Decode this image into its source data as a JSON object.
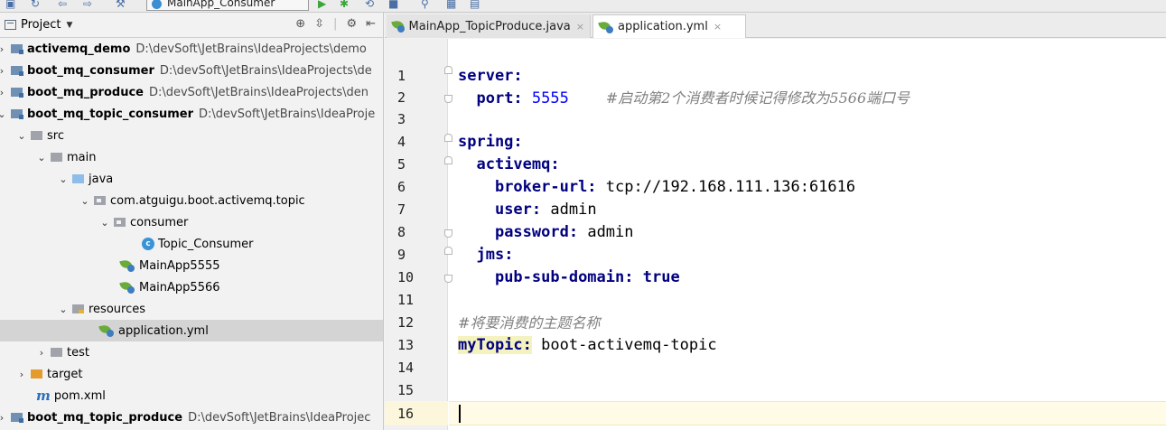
{
  "toolbar": {
    "run_config_label": "MainApp_Consumer"
  },
  "project_panel": {
    "title": "Project",
    "tree": [
      {
        "label": "activemq_demo",
        "path": "D:\\devSoft\\JetBrains\\IdeaProjects\\demo"
      },
      {
        "label": "boot_mq_consumer",
        "path": "D:\\devSoft\\JetBrains\\IdeaProjects\\de"
      },
      {
        "label": "boot_mq_produce",
        "path": "D:\\devSoft\\JetBrains\\IdeaProjects\\den"
      },
      {
        "label": "boot_mq_topic_consumer",
        "path": "D:\\devSoft\\JetBrains\\IdeaProje"
      },
      {
        "label": "src"
      },
      {
        "label": "main"
      },
      {
        "label": "java"
      },
      {
        "label": "com.atguigu.boot.activemq.topic"
      },
      {
        "label": "consumer"
      },
      {
        "label": "Topic_Consumer"
      },
      {
        "label": "MainApp5555"
      },
      {
        "label": "MainApp5566"
      },
      {
        "label": "resources"
      },
      {
        "label": "application.yml"
      },
      {
        "label": "test"
      },
      {
        "label": "target"
      },
      {
        "label": "pom.xml"
      },
      {
        "label": "boot_mq_topic_produce",
        "path": "D:\\devSoft\\JetBrains\\IdeaProjec"
      }
    ]
  },
  "tabs": [
    {
      "label": "MainApp_TopicProduce.java",
      "close": "×"
    },
    {
      "label": "application.yml",
      "close": "×"
    }
  ],
  "editor": {
    "line_numbers": [
      "1",
      "2",
      "3",
      "4",
      "5",
      "6",
      "7",
      "8",
      "9",
      "10",
      "11",
      "12",
      "13",
      "14",
      "15",
      "16"
    ],
    "code": {
      "l1_key": "server:",
      "l2_key": "port:",
      "l2_val": "5555",
      "l2_comment": "#启动第2个消费者时候记得修改为5566端口号",
      "l4_key": "spring:",
      "l5_key": "activemq:",
      "l6_key": "broker-url:",
      "l6_val": "tcp://192.168.111.136:61616",
      "l7_key": "user:",
      "l7_val": "admin",
      "l8_key": "password:",
      "l8_val": "admin",
      "l9_key": "jms:",
      "l10_key": "pub-sub-domain:",
      "l10_val": "true",
      "l12_comment": "#将要消费的主题名称",
      "l13_key": "myTopic:",
      "l13_val": "boot-activemq-topic"
    }
  },
  "colors": {
    "yaml_key": "#000080",
    "number": "#0000ff",
    "comment": "#808080",
    "current_line": "#fffbe6",
    "selection": "#d4d4d4"
  }
}
